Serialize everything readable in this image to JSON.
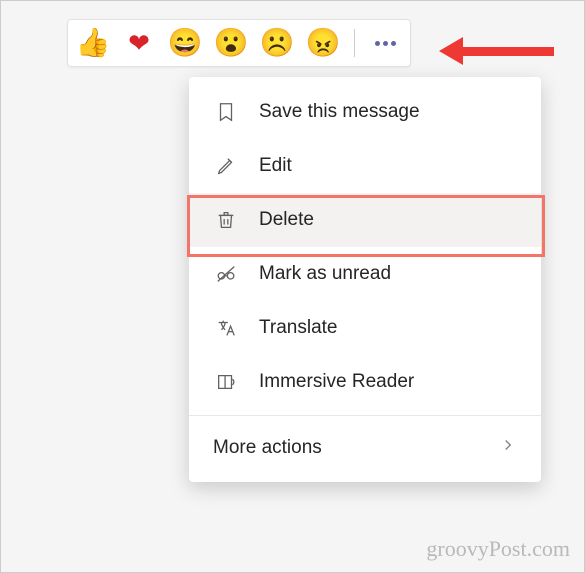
{
  "reactions": {
    "emojis": [
      "👍",
      "❤",
      "😄",
      "😮",
      "☹️",
      "😠"
    ]
  },
  "menu": {
    "items": [
      {
        "label": "Save this message",
        "icon": "bookmark-icon"
      },
      {
        "label": "Edit",
        "icon": "pencil-icon"
      },
      {
        "label": "Delete",
        "icon": "trash-icon",
        "hovered": true
      },
      {
        "label": "Mark as unread",
        "icon": "glasses-off-icon"
      },
      {
        "label": "Translate",
        "icon": "translate-icon"
      },
      {
        "label": "Immersive Reader",
        "icon": "reader-icon"
      }
    ],
    "more": "More actions"
  },
  "watermark": "groovyPost.com"
}
